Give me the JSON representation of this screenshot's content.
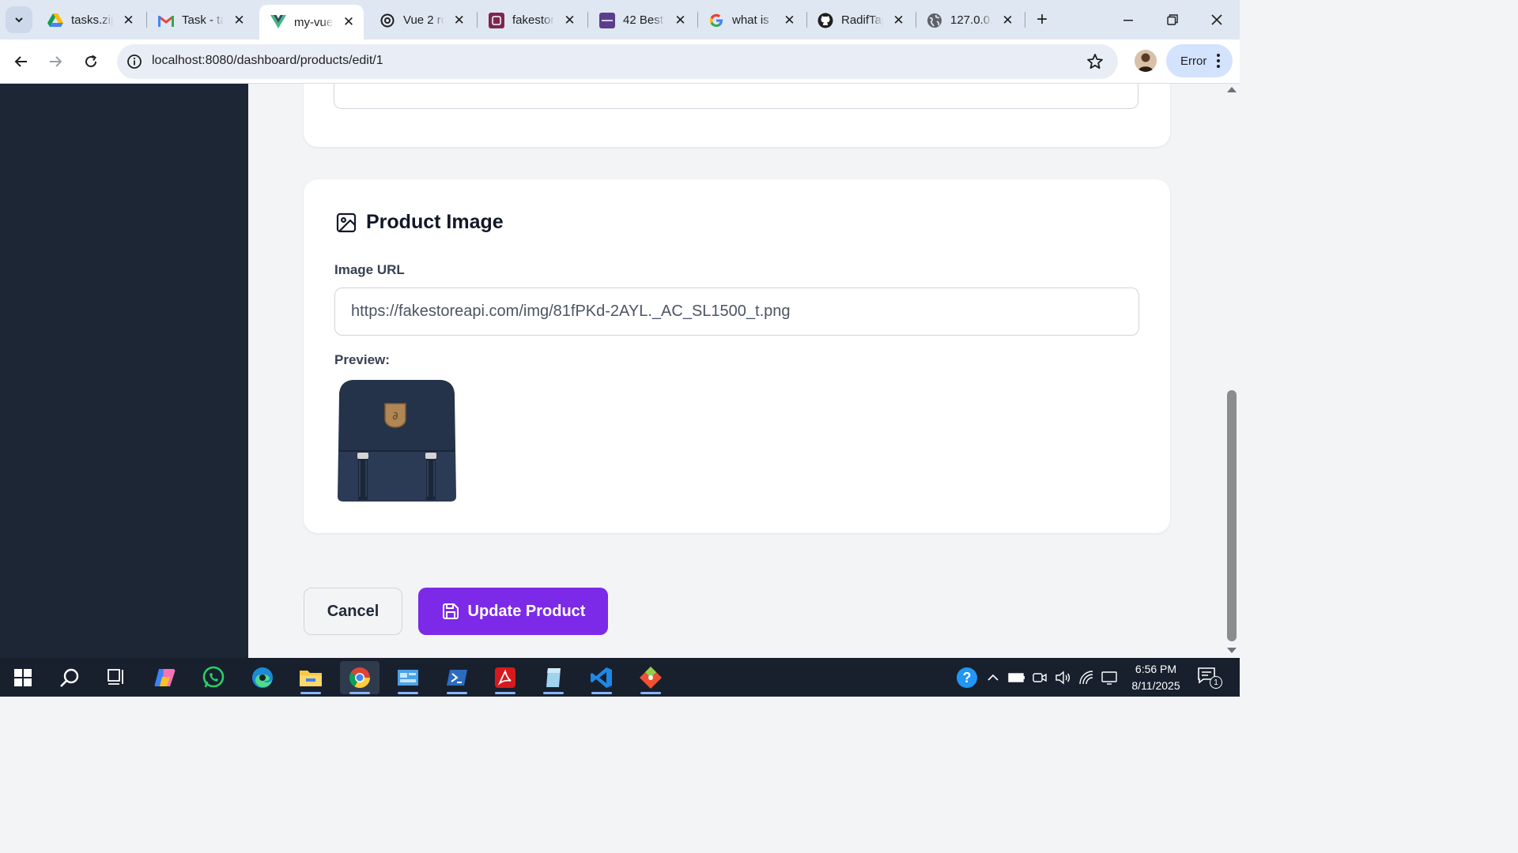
{
  "browser": {
    "tabs": [
      {
        "title": "tasks.zip",
        "icon": "google-drive-icon",
        "active": false
      },
      {
        "title": "Task - ta",
        "icon": "gmail-icon",
        "active": false
      },
      {
        "title": "my-vue",
        "icon": "vue-icon",
        "active": true
      },
      {
        "title": "Vue 2 ro",
        "icon": "openai-icon",
        "active": false
      },
      {
        "title": "fakestor",
        "icon": "fakestore-icon",
        "active": false
      },
      {
        "title": "42 Best",
        "icon": "colorlib-icon",
        "active": false
      },
      {
        "title": "what is",
        "icon": "google-icon",
        "active": false
      },
      {
        "title": "RadifTaj",
        "icon": "github-icon",
        "active": false
      },
      {
        "title": "127.0.0.",
        "icon": "globe-icon",
        "active": false
      }
    ],
    "url": "localhost:8080/dashboard/products/edit/1",
    "profile_status": "Error"
  },
  "page": {
    "section_title": "Product Image",
    "image_url_label": "Image URL",
    "image_url_value": "https://fakestoreapi.com/img/81fPKd-2AYL._AC_SL1500_t.png",
    "preview_label": "Preview:",
    "cancel_label": "Cancel",
    "update_label": "Update Product",
    "accent_color": "#7c2ae8"
  },
  "taskbar": {
    "apps": [
      "windows-start-icon",
      "search-icon",
      "task-view-icon",
      "copilot-icon",
      "whatsapp-icon",
      "edge-icon",
      "file-explorer-icon",
      "chrome-icon",
      "control-panel-icon",
      "powershell-icon",
      "acrobat-icon",
      "notes-icon",
      "vscode-icon",
      "git-icon"
    ],
    "time": "6:56 PM",
    "date": "8/11/2025",
    "notification_count": "1"
  }
}
